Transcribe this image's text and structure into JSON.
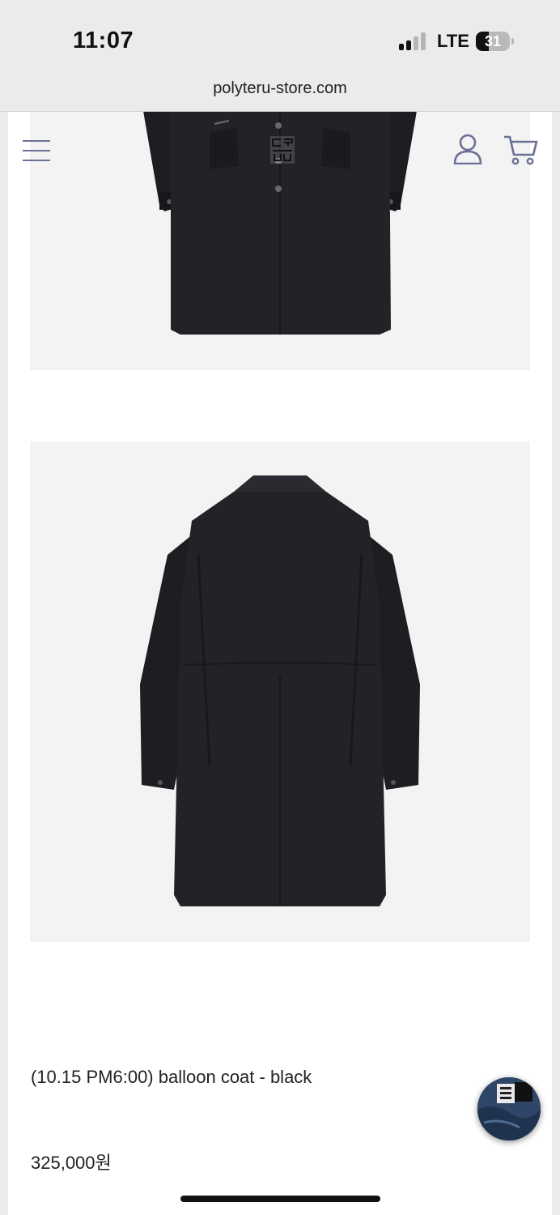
{
  "status_bar": {
    "time": "11:07",
    "network": "LTE",
    "battery": "31"
  },
  "browser": {
    "url": "polyteru-store.com"
  },
  "header": {
    "menu_icon": "hamburger-menu-icon",
    "account_icon": "user-icon",
    "cart_icon": "cart-icon",
    "accent_color": "#6b7096"
  },
  "images": [
    {
      "name": "product-photo-front",
      "logo_text": "폴리테루"
    },
    {
      "name": "product-photo-back"
    }
  ],
  "product": {
    "title": "(10.15 PM6:00) balloon coat - black",
    "price": "325,000원"
  },
  "floating_button": {
    "icon": "product-thumbnail"
  }
}
